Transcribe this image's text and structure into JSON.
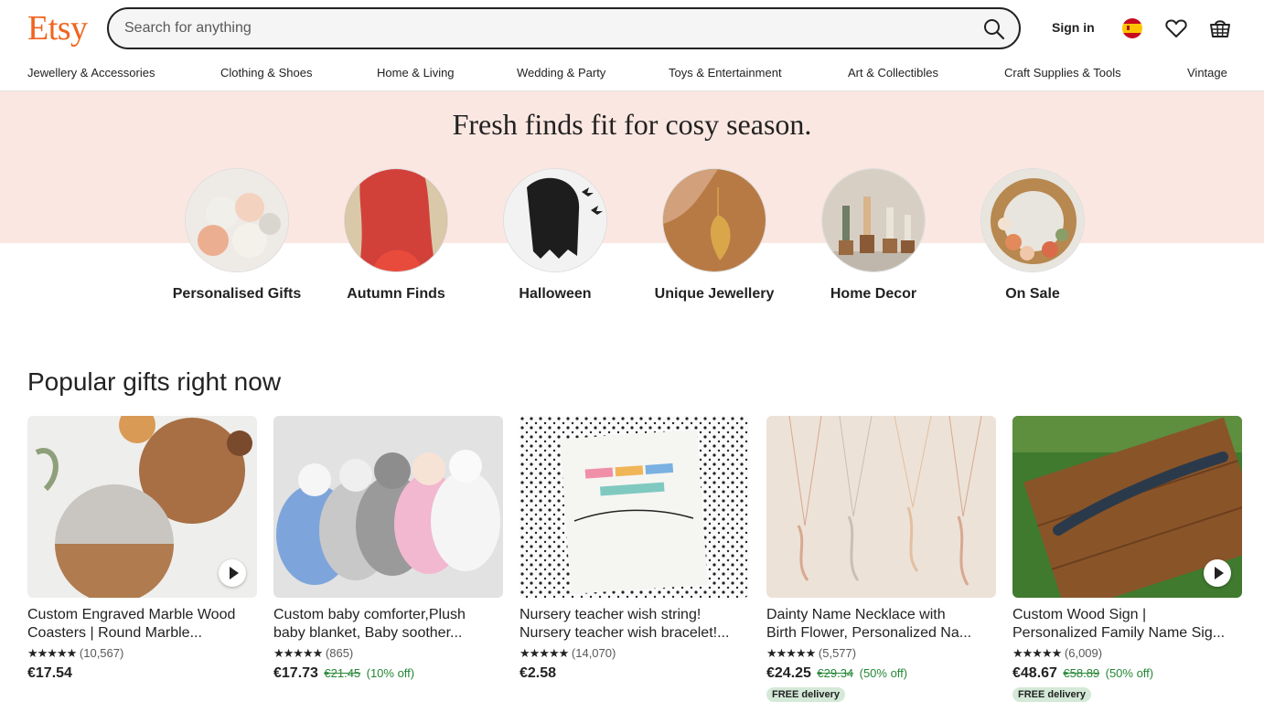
{
  "header": {
    "logo": "Etsy",
    "search_placeholder": "Search for anything",
    "sign_in": "Sign in"
  },
  "nav": {
    "items": [
      "Jewellery & Accessories",
      "Clothing & Shoes",
      "Home & Living",
      "Wedding & Party",
      "Toys & Entertainment",
      "Art & Collectibles",
      "Craft Supplies & Tools",
      "Vintage"
    ]
  },
  "hero": {
    "title": "Fresh finds fit for cosy season.",
    "categories": [
      {
        "label": "Personalised Gifts"
      },
      {
        "label": "Autumn Finds"
      },
      {
        "label": "Halloween"
      },
      {
        "label": "Unique Jewellery"
      },
      {
        "label": "Home Decor"
      },
      {
        "label": "On Sale"
      }
    ]
  },
  "popular": {
    "title": "Popular gifts right now",
    "items": [
      {
        "title_line1": "Custom Engraved Marble Wood",
        "title_line2": "Coasters | Round Marble...",
        "stars": "★★★★★",
        "reviews": "(10,567)",
        "price": "€17.54",
        "original_price": "",
        "discount": "",
        "badge": ""
      },
      {
        "title_line1": "Custom baby comforter,Plush",
        "title_line2": "baby blanket, Baby soother...",
        "stars": "★★★★★",
        "reviews": "(865)",
        "price": "€17.73",
        "original_price": "€21.45",
        "discount": "(10% off)",
        "badge": ""
      },
      {
        "title_line1": "Nursery teacher wish string!",
        "title_line2": "Nursery teacher wish bracelet!...",
        "stars": "★★★★★",
        "reviews": "(14,070)",
        "price": "€2.58",
        "original_price": "",
        "discount": "",
        "badge": ""
      },
      {
        "title_line1": "Dainty Name Necklace with",
        "title_line2": "Birth Flower, Personalized Na...",
        "stars": "★★★★★",
        "reviews": "(5,577)",
        "price": "€24.25",
        "original_price": "€29.34",
        "discount": "(50% off)",
        "badge": "FREE delivery"
      },
      {
        "title_line1": "Custom Wood Sign |",
        "title_line2": "Personalized Family Name Sig...",
        "stars": "★★★★★",
        "reviews": "(6,009)",
        "price": "€48.67",
        "original_price": "€58.89",
        "discount": "(50% off)",
        "badge": "FREE delivery"
      }
    ]
  },
  "colors": {
    "brand": "#f1641e",
    "hero_band": "#fbe7e1",
    "sale_green": "#258635",
    "badge_bg": "#d4e9d7"
  },
  "icons": [
    "search-icon",
    "flag-icon",
    "heart-icon",
    "basket-icon",
    "play-icon"
  ]
}
